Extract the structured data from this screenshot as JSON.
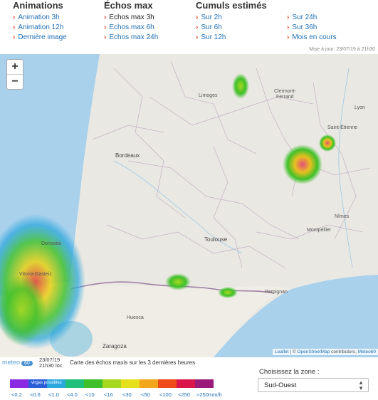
{
  "nav": {
    "animations": {
      "title": "Animations",
      "links": [
        "Animation 3h",
        "Animation 12h",
        "Dernière image"
      ]
    },
    "echos": {
      "title": "Échos max",
      "links": [
        "Echos max 3h",
        "Echos max 6h",
        "Echos max 24h"
      ]
    },
    "cumuls": {
      "title": "Cumuls estimés",
      "links_a": [
        "Sur 2h",
        "Sur 6h",
        "Sur 12h"
      ],
      "links_b": [
        "Sur 24h",
        "Sur 36h",
        "Mois en cours"
      ]
    }
  },
  "updated": "Mise à jour: 23/07/19 à 21h30",
  "map": {
    "zoom_in": "+",
    "zoom_out": "−",
    "cities": {
      "limoges": "Limoges",
      "clermont": "Clermont-",
      "ferrand": "Ferrand",
      "lyon": "Lyon",
      "saint_etienne": "Saint-Étienne",
      "bordeaux": "Bordeaux",
      "toulouse": "Toulouse",
      "montpellier": "Montpellier",
      "nimes": "Nîmes",
      "perpignan": "Perpignan",
      "huesca": "Huesca",
      "zaragoza": "Zaragoza",
      "vitoria": "Vitoria-Gasteiz",
      "donostia": "Donostia"
    },
    "attribution": {
      "leaflet": "Leaflet",
      "sep": " | © ",
      "osm": "OpenStreetMap",
      "contrib": " contributors, ",
      "meteo60": "Meteo60"
    }
  },
  "footer": {
    "logo": "meteo",
    "logo_badge": "60",
    "date": "23/07/19",
    "time": "21h30 loc.",
    "caption": "Carte des échos maxis sur les 3 dernières heures"
  },
  "legend": {
    "title": "virgas possibles",
    "unit": "mm/h",
    "levels": [
      "<0.2",
      "<0.6",
      "<1.0",
      "<4.0",
      "<10",
      "<16",
      "<30",
      "<50",
      "<100",
      "<250",
      ">250"
    ],
    "colors": [
      "#8a2be2",
      "#2b5fd9",
      "#29a8e0",
      "#20c07a",
      "#3fc02a",
      "#a7d820",
      "#e6e01c",
      "#f2a61c",
      "#ef4c1a",
      "#d9154a",
      "#9a1a7a"
    ]
  },
  "zone": {
    "label": "Choisissez la zone :",
    "value": "Sud-Ouest"
  }
}
